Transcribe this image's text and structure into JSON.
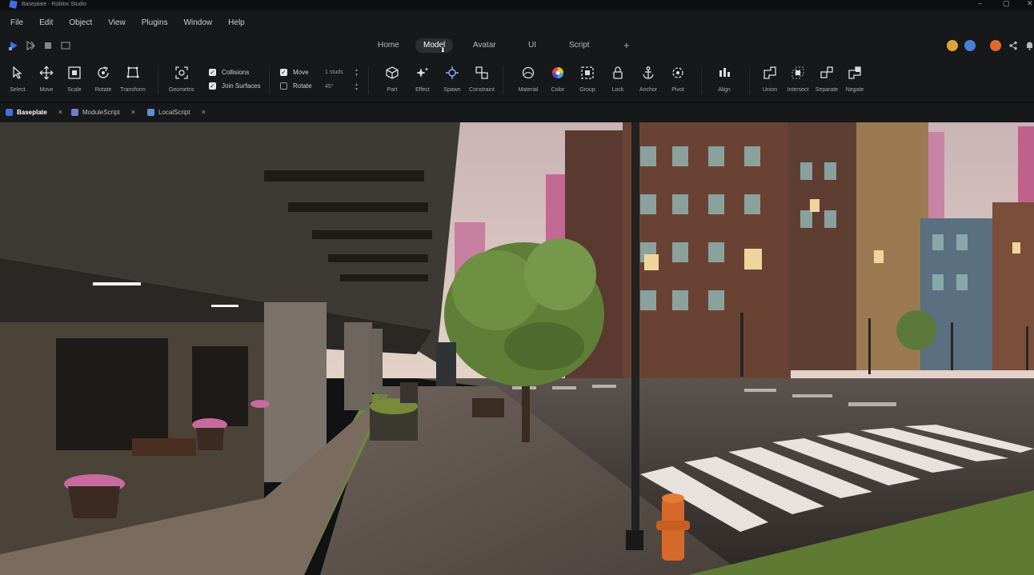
{
  "window": {
    "title": "Baseplate - Roblox Studio"
  },
  "menu": [
    "File",
    "Edit",
    "Object",
    "View",
    "Plugins",
    "Window",
    "Help"
  ],
  "main_tabs": [
    {
      "label": "Home",
      "active": false
    },
    {
      "label": "Model",
      "active": true
    },
    {
      "label": "Avatar",
      "active": false
    },
    {
      "label": "UI",
      "active": false
    },
    {
      "label": "Script",
      "active": false
    }
  ],
  "toolbar": {
    "transform_tools": [
      "Select",
      "Move",
      "Scale",
      "Rotate",
      "Transform"
    ],
    "geometric": "Geometric",
    "collisions": {
      "label": "Collisions",
      "checked": true
    },
    "join_surfaces": {
      "label": "Join Surfaces",
      "checked": true
    },
    "move_snap": {
      "label": "Move",
      "checked": true,
      "value": "1 studs"
    },
    "rotate_snap": {
      "label": "Rotate",
      "checked": false,
      "value": "45°"
    },
    "insert_tools": [
      "Part",
      "Effect",
      "Spawn",
      "Constraint"
    ],
    "appearance_tools": [
      "Material",
      "Color",
      "Group",
      "Lock",
      "Anchor",
      "Pivot"
    ],
    "align": "Align",
    "solid_tools": [
      "Union",
      "Intersect",
      "Separate",
      "Negate"
    ]
  },
  "doc_tabs": [
    {
      "label": "Baseplate",
      "active": true
    },
    {
      "label": "ModuleScript",
      "active": false
    },
    {
      "label": "LocalScript",
      "active": false
    }
  ],
  "colors": {
    "accent": "#3f6fe0",
    "active_tab_bg": "#2c2e32",
    "toolbar_bg": "#17181a"
  }
}
